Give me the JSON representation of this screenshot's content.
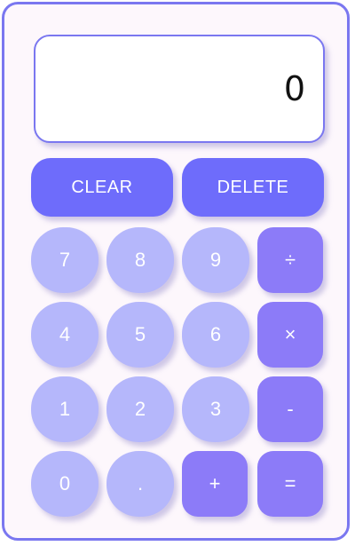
{
  "display": {
    "value": "0"
  },
  "controls": {
    "clear_label": "CLEAR",
    "delete_label": "DELETE"
  },
  "keys": {
    "seven": "7",
    "eight": "8",
    "nine": "9",
    "divide": "÷",
    "four": "4",
    "five": "5",
    "six": "6",
    "multiply": "×",
    "one": "1",
    "two": "2",
    "three": "3",
    "subtract": "-",
    "zero": "0",
    "decimal": ".",
    "add": "+",
    "equals": "="
  },
  "colors": {
    "accent": "#6e6cfb",
    "number_key": "#b5b7fb",
    "operator_key": "#8c7bf8",
    "border": "#7a77f0",
    "background": "#fdf7fc"
  }
}
